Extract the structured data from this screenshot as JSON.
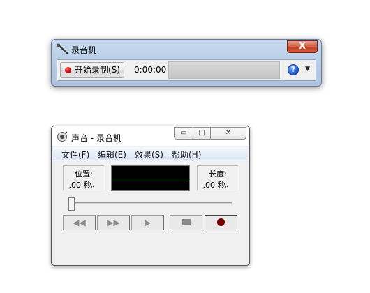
{
  "recorder": {
    "title": "录音机",
    "close_label": "X",
    "start_recording_label": "开始录制(S)",
    "elapsed_time": "0:00:00",
    "help_glyph": "?",
    "dropdown_glyph": "▼",
    "icons": {
      "app": "microphone-icon",
      "record": "record-dot-icon",
      "help": "help-icon",
      "dropdown": "chevron-down-icon"
    }
  },
  "classic_recorder": {
    "title": "声音 - 录音机",
    "caption_buttons": {
      "minimize": "▭",
      "maximize": "□",
      "close": "✕"
    },
    "menu": [
      {
        "label": "文件(F)"
      },
      {
        "label": "编辑(E)"
      },
      {
        "label": "效果(S)"
      },
      {
        "label": "帮助(H)"
      }
    ],
    "position_label": "位置:",
    "position_value": ".00 秒。",
    "length_label": "长度:",
    "length_value": ".00 秒。",
    "transport": {
      "rewind_glyph": "◀◀",
      "fast_forward_glyph": "▶▶",
      "play_glyph": "▶"
    },
    "colors": {
      "waveform_bg": "#000000",
      "waveform_line": "#3da84d",
      "record_dot": "#7a0000"
    }
  }
}
